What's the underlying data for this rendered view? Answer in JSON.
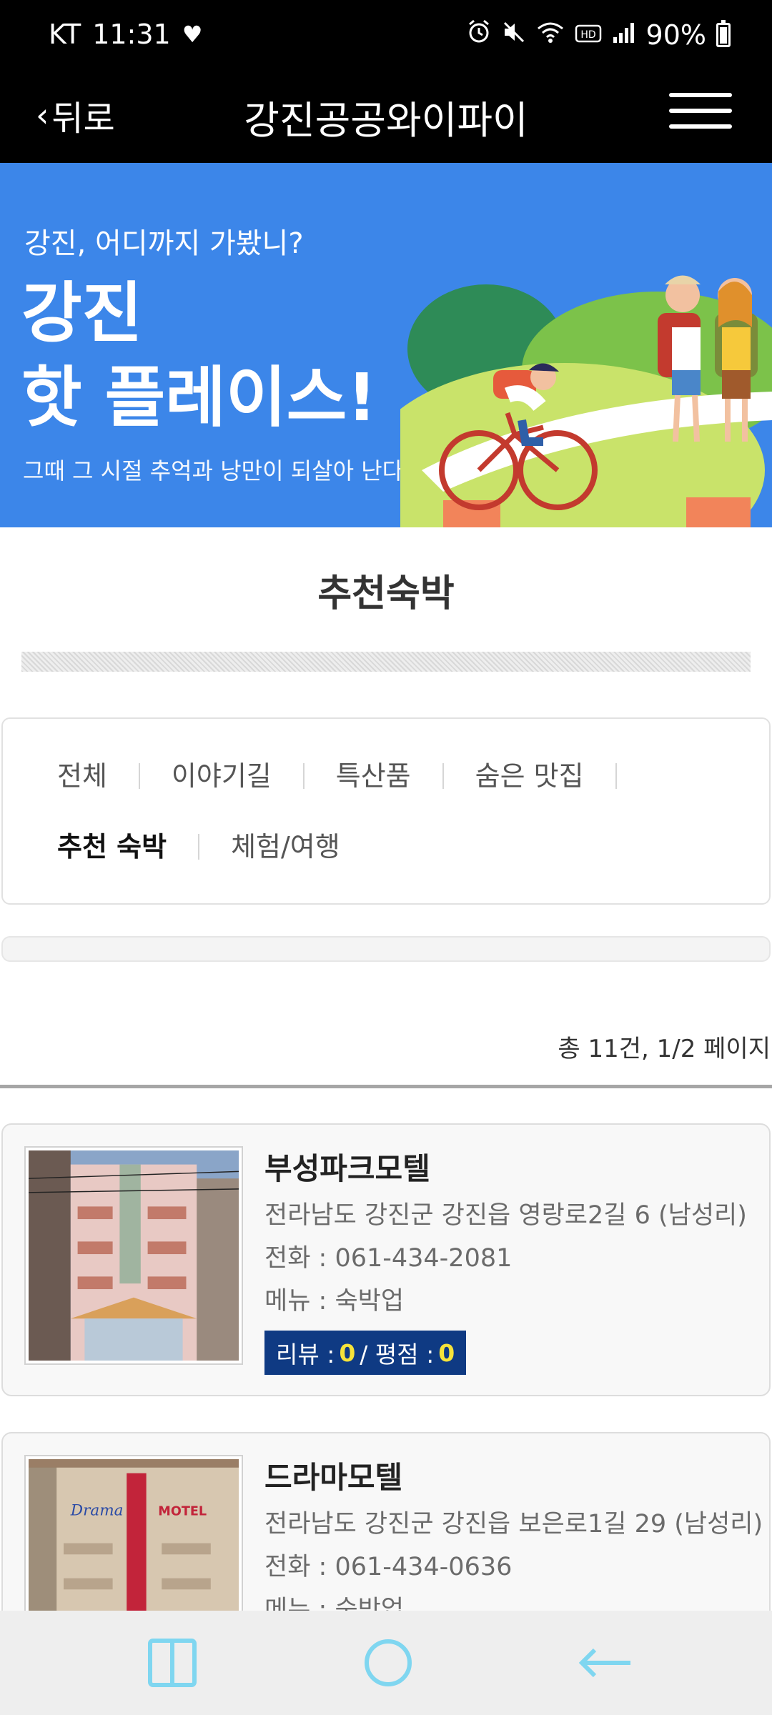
{
  "status_bar": {
    "carrier": "KT",
    "time": "11:31",
    "battery": "90%",
    "icons": [
      "heart-icon",
      "alarm-icon",
      "mute-icon",
      "wifi-icon",
      "hd-icon",
      "signal-icon",
      "battery-icon"
    ]
  },
  "header": {
    "back_label": "뒤로",
    "title": "강진공공와이파이"
  },
  "banner": {
    "question": "강진, 어디까지 가봤니?",
    "headline_line1": "강진",
    "headline_line2": "핫 플레이스!",
    "subtitle": "그때 그 시절 추억과 낭만이 되살아 난다."
  },
  "section": {
    "title": "추천숙박"
  },
  "categories": [
    {
      "label": "전체",
      "active": false
    },
    {
      "label": "이야기길",
      "active": false
    },
    {
      "label": "특산품",
      "active": false
    },
    {
      "label": "숨은 맛집",
      "active": false
    },
    {
      "label": "추천 숙박",
      "active": true
    },
    {
      "label": "체험/여행",
      "active": false
    }
  ],
  "list_info": {
    "total_text": "총 11건, 1/2 페이지"
  },
  "listings": [
    {
      "name": "부성파크모텔",
      "address": "전라남도 강진군 강진읍 영랑로2길 6 (남성리)",
      "phone": "전화 : 061-434-2081",
      "menu": "메뉴 : 숙박업",
      "review_label": "리뷰 :",
      "review_count": "0",
      "rating_label": "/ 평점 :",
      "rating": "0"
    },
    {
      "name": "드라마모텔",
      "address": "전라남도 강진군 강진읍 보은로1길 29 (남성리)",
      "phone": "전화 : 061-434-0636",
      "menu": "메뉴 : 숙박업"
    }
  ],
  "colors": {
    "header_bg": "#000000",
    "banner_bg": "#3c86e9",
    "badge_bg": "#0f3a83",
    "badge_number": "#f6e33a"
  },
  "nav": {
    "icons": [
      "recent-apps-icon",
      "home-icon",
      "back-arrow-icon"
    ]
  }
}
